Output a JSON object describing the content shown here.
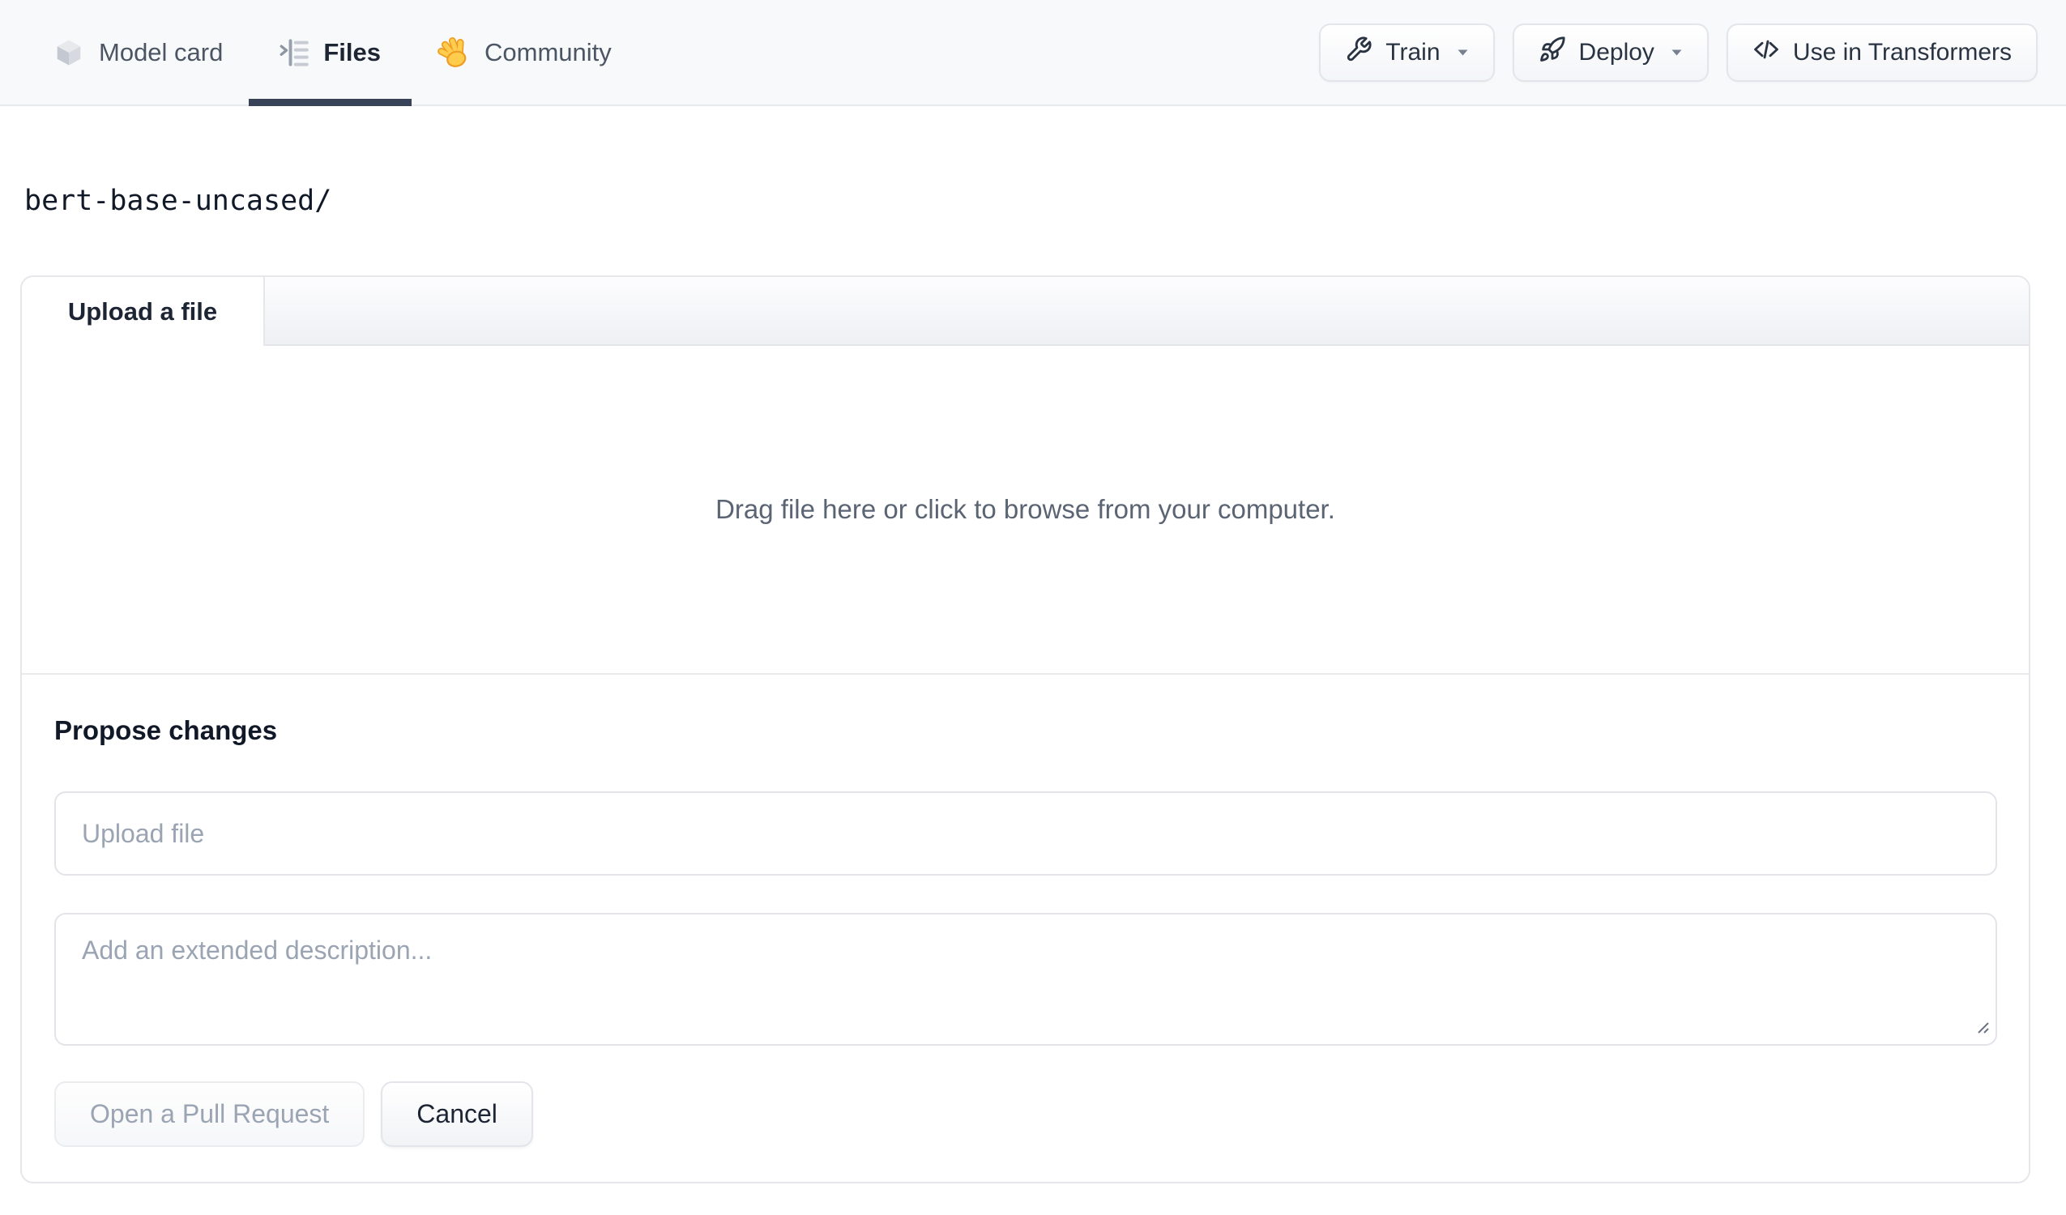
{
  "nav": {
    "tabs": [
      {
        "label": "Model card",
        "icon": "cube-icon",
        "active": false
      },
      {
        "label": "Files",
        "icon": "file-versions-icon",
        "active": true
      },
      {
        "label": "Community",
        "icon": "waving-hand-icon",
        "active": false
      }
    ],
    "actions": [
      {
        "label": "Train",
        "icon": "wrench-icon",
        "has_dropdown": true
      },
      {
        "label": "Deploy",
        "icon": "rocket-icon",
        "has_dropdown": true
      },
      {
        "label": "Use in Transformers",
        "icon": "code-icon",
        "has_dropdown": false
      }
    ]
  },
  "path": {
    "current": "bert-base-uncased/"
  },
  "upload_panel": {
    "tab_label": "Upload a file",
    "dropzone_text": "Drag file here or click to browse from your computer.",
    "propose": {
      "heading": "Propose changes",
      "filename_placeholder": "Upload file",
      "description_placeholder": "Add an extended description...",
      "submit_label": "Open a Pull Request",
      "submit_enabled": false,
      "cancel_label": "Cancel"
    }
  },
  "colors": {
    "nav_background": "#f8f9fb",
    "active_tab_underline": "#384357",
    "panel_border": "#e5e7eb",
    "tab_strip_gradient_bottom": "#eef0f4",
    "muted_text": "#5b6473",
    "placeholder_text": "#9aa4b2",
    "primary_text": "#1d2433",
    "disabled_text": "#9aa4b2",
    "hand_emoji_yellow": "#FFCC4D",
    "hand_emoji_outline": "#EE9D23"
  }
}
